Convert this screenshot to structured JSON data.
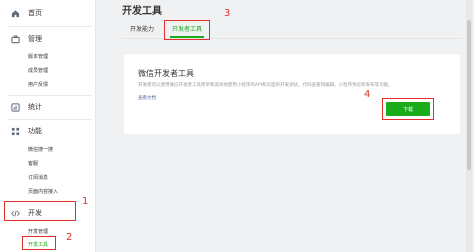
{
  "sidebar": {
    "home": "首页",
    "manage": {
      "label": "管理",
      "items": [
        "版本管理",
        "成员管理",
        "用户反馈"
      ]
    },
    "stats": "统计",
    "features": {
      "label": "功能",
      "items": [
        "微信搜一搜",
        "客服",
        "订阅消息",
        "页面内容接入"
      ]
    },
    "develop": {
      "label": "开发",
      "items": [
        "开发管理",
        "开发工具"
      ]
    }
  },
  "main": {
    "title": "开发工具",
    "tabs": [
      {
        "label": "开发能力"
      },
      {
        "label": "开发者工具"
      }
    ],
    "card": {
      "title": "微信开发者工具",
      "description": "开发者可以使用微信开发者工具简单和高效地使用小程序的API和页面的开发调试，代码查看和编辑，小程序预览和发布等功能。",
      "link": "查看文档",
      "download_button": "下载"
    }
  },
  "annotations": {
    "labels": [
      "1",
      "2",
      "3",
      "4"
    ],
    "color": "#e0302a"
  },
  "colors": {
    "accent": "#1aad19",
    "link": "#576b95"
  }
}
